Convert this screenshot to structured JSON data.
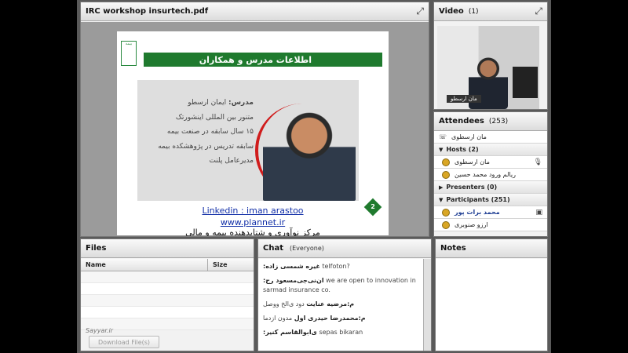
{
  "share": {
    "title": "IRC workshop insurtech.pdf",
    "slide": {
      "logo_text": "بیمه",
      "banner": "اطلاعات مدرس و همکاران",
      "bio_label": "مدرس:",
      "bio_name": "ایمان ارسطو",
      "bio_lines": [
        "متنور بین المللی اینشورتک",
        "۱۵ سال سابقه در صنعت بیمه",
        "سابقه تدریس در پژوهشکده بیمه",
        "مدیرعامل پلنت"
      ],
      "page_number": "2",
      "linkedin": "Linkedin : iman arastoo",
      "website": "www.plannet.ir",
      "footer": "مرکز نوآوری و شتابدهنده بیمه و مالی"
    }
  },
  "video": {
    "title": "Video",
    "count": "(1)",
    "name_tag": "مان ارسطو"
  },
  "attendees": {
    "title": "Attendees",
    "count": "(253)",
    "me": "مان ارسطوی",
    "hosts_label": "Hosts (2)",
    "hosts": [
      "مان ارسطوی",
      "ریالم ورود محمد حسین"
    ],
    "presenters_label": "Presenters (0)",
    "participants_label": "Participants (251)",
    "participants": [
      "محمد برات پور",
      "ارزو صنوبری"
    ]
  },
  "files": {
    "title": "Files",
    "col_name": "Name",
    "col_size": "Size",
    "download_label": "Download File(s)",
    "watermark": "Sayyar.ir"
  },
  "chat": {
    "title": "Chat",
    "scope": "(Everyone)",
    "messages": [
      {
        "who": "غیره شمسی زاده:",
        "text": "telfoton?"
      },
      {
        "who": "ان‌نی‌جی‌مسعود رح:",
        "text": "we are open to innovation in sarmad insurance co."
      },
      {
        "who": "م:مرضیه عنایت",
        "text": "دود ی‌الخ ووصل"
      },
      {
        "who": "م:محمدرضا حیدری اول",
        "text": "مدون ازدما"
      },
      {
        "who": "ی‌ابوالقاسم کنیر:",
        "text": "sepas bikaran"
      }
    ]
  },
  "notes": {
    "title": "Notes"
  },
  "icons": {
    "fullscreen": "fullscreen-icon",
    "user": "user-icon",
    "microphone": "microphone-icon",
    "webcam": "webcam-icon"
  }
}
